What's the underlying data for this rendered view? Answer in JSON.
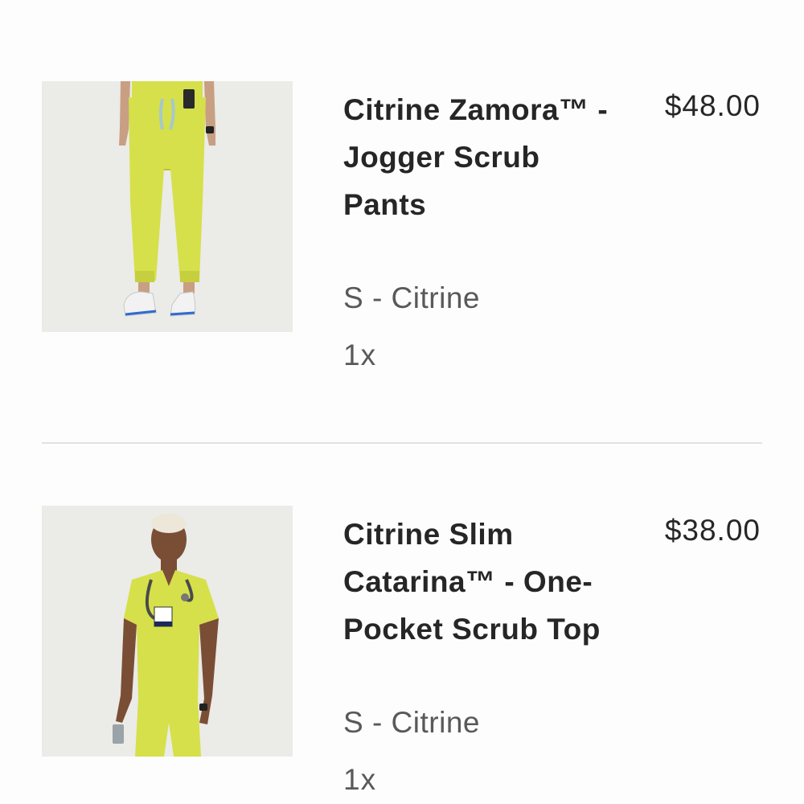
{
  "cart": {
    "items": [
      {
        "title": "Citrine Zamora™ - Jogger Scrub Pants",
        "variant": "S - Citrine",
        "quantity": "1x",
        "price": "$48.00",
        "image": "jogger-scrub-pants-photo",
        "color": "#d6e04a"
      },
      {
        "title": "Citrine Slim Catarina™ - One-Pocket Scrub Top",
        "variant": "S - Citrine",
        "quantity": "1x",
        "price": "$38.00",
        "image": "scrub-top-photo",
        "color": "#d6e04a"
      }
    ]
  }
}
